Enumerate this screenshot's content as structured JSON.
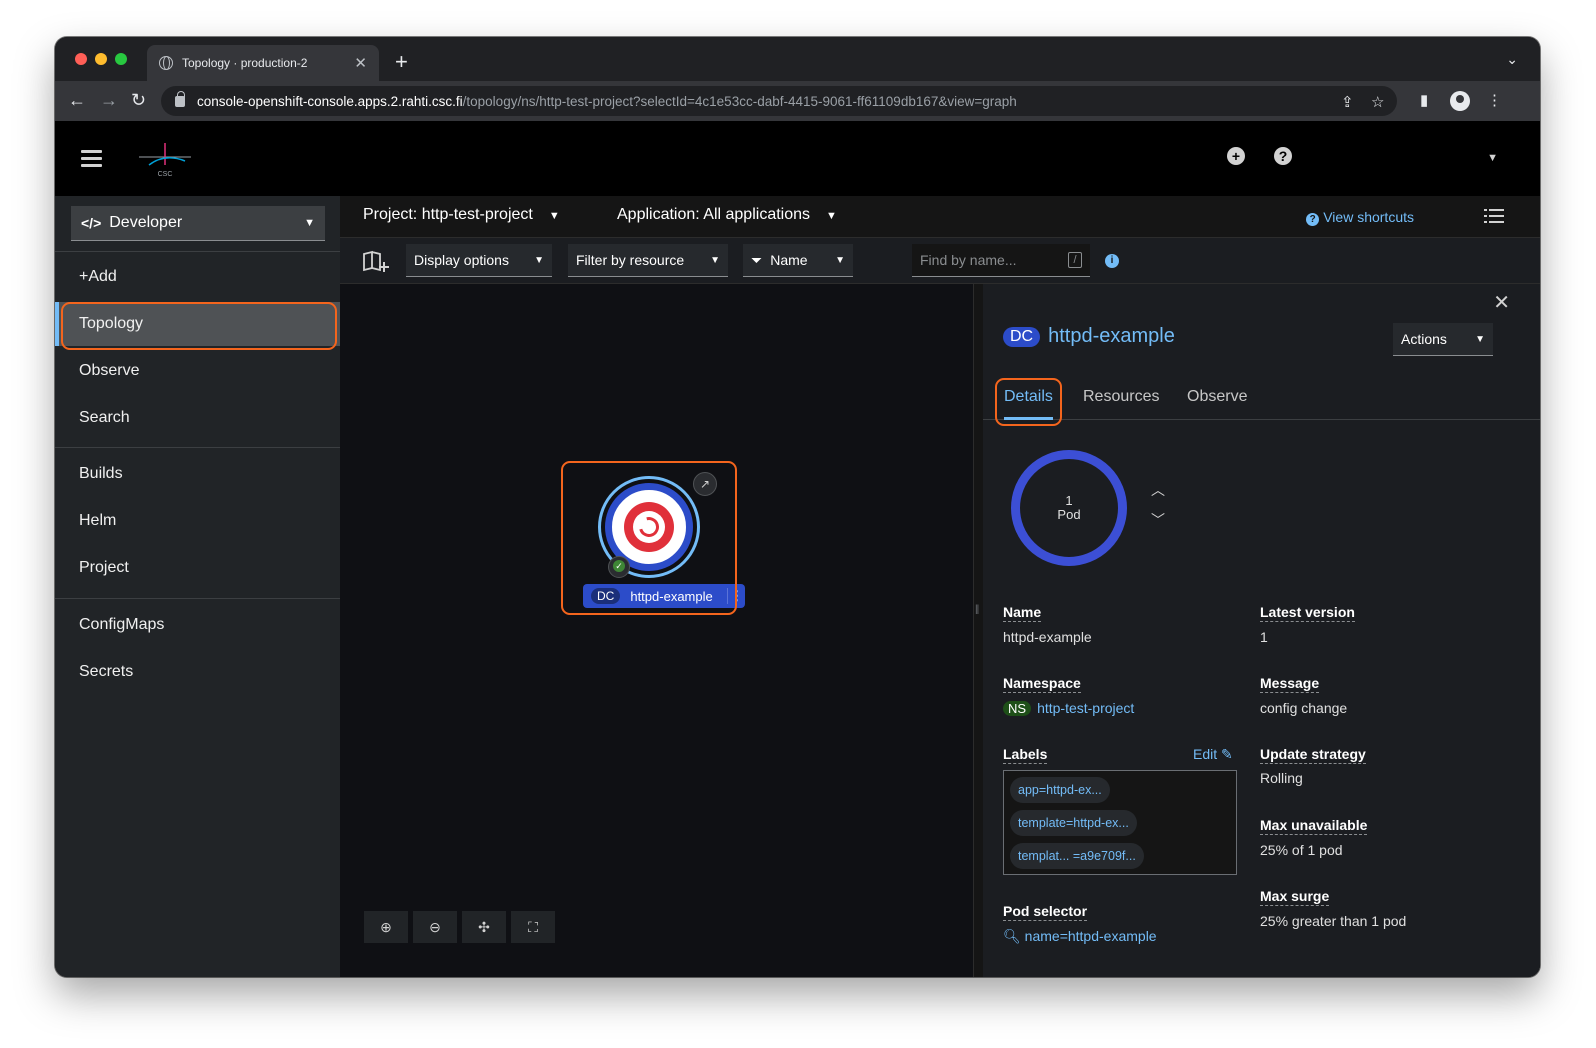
{
  "browser": {
    "tab_title": "Topology · production-2",
    "url_host": "console-openshift-console.apps.2.rahti.csc.fi",
    "url_path": "/topology/ns/http-test-project?selectId=4c1e53cc-dabf-4415-9061-ff61109db167&view=graph"
  },
  "masthead": {
    "logo_text": "CSC"
  },
  "sidebar": {
    "perspective": "Developer",
    "items": [
      "+Add",
      "Topology",
      "Observe",
      "Search",
      "Builds",
      "Helm",
      "Project",
      "ConfigMaps",
      "Secrets"
    ]
  },
  "toolbar": {
    "project": "Project: http-test-project",
    "application": "Application: All applications",
    "view_shortcuts": "View shortcuts",
    "display_options": "Display options",
    "filter_by_resource": "Filter by resource",
    "filter_type": "Name",
    "find_placeholder": "Find by name...",
    "slash_hint": "/"
  },
  "node": {
    "badge": "DC",
    "name": "httpd-example"
  },
  "panel": {
    "badge": "DC",
    "title": "httpd-example",
    "actions": "Actions",
    "tabs": [
      "Details",
      "Resources",
      "Observe"
    ],
    "pod_count": "1",
    "pod_label": "Pod",
    "edit": "Edit",
    "details": {
      "name_label": "Name",
      "name_value": "httpd-example",
      "namespace_label": "Namespace",
      "ns_badge": "NS",
      "namespace_value": "http-test-project",
      "labels_label": "Labels",
      "labels": [
        "app=httpd-ex...",
        "template=httpd-ex...",
        "templat... =a9e709f..."
      ],
      "pod_selector_label": "Pod selector",
      "pod_selector_value": "name=httpd-example",
      "latest_version_label": "Latest version",
      "latest_version_value": "1",
      "message_label": "Message",
      "message_value": "config change",
      "update_strategy_label": "Update strategy",
      "update_strategy_value": "Rolling",
      "max_unavailable_label": "Max unavailable",
      "max_unavailable_value": "25% of 1 pod",
      "max_surge_label": "Max surge",
      "max_surge_value": "25% greater than 1 pod"
    }
  },
  "colors": {
    "accent_link": "#73bcf7",
    "highlight": "#f4651d",
    "node_blue": "#2c4cc9"
  }
}
